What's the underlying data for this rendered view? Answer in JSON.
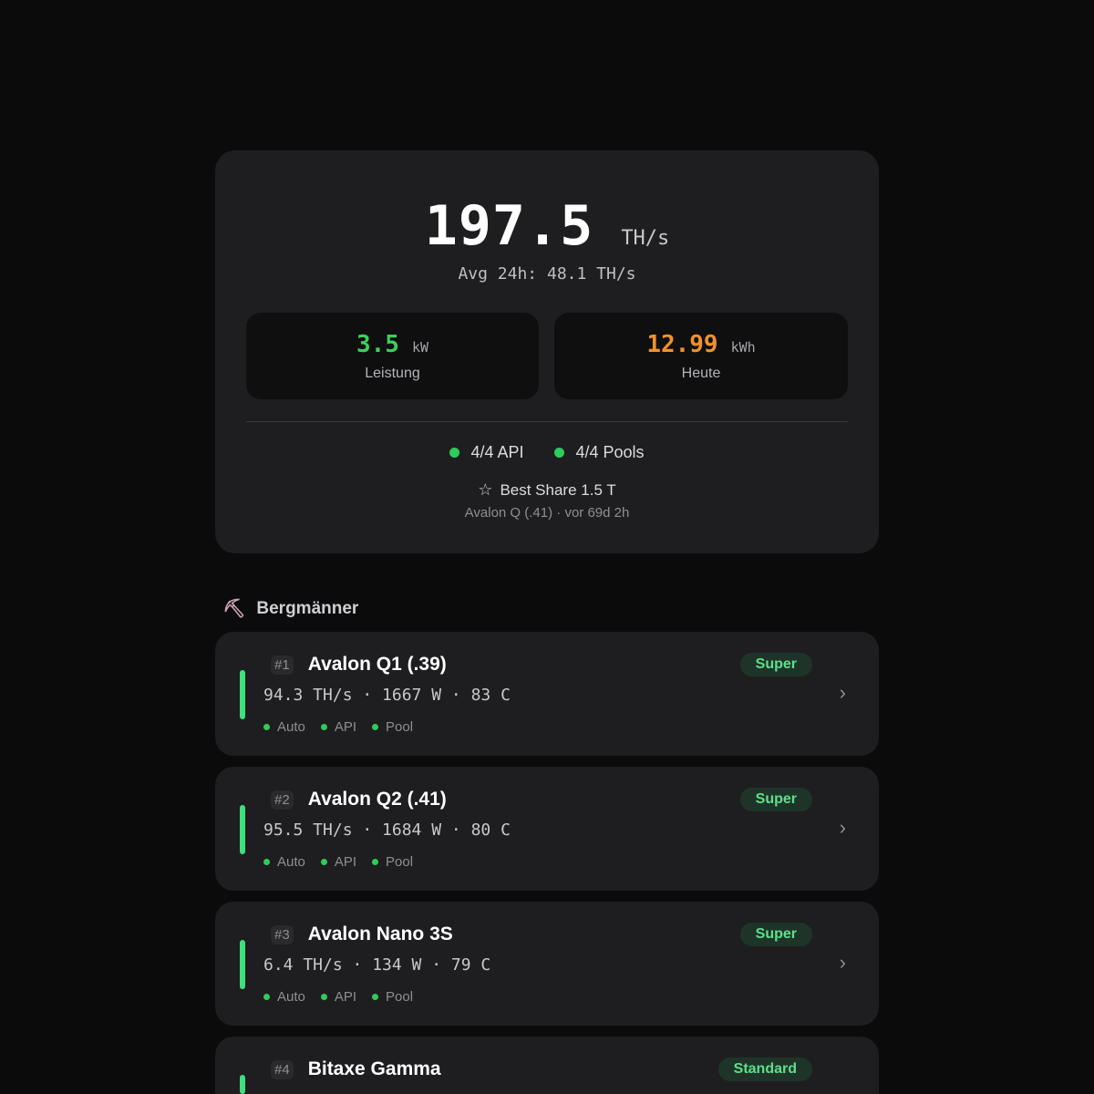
{
  "summary": {
    "hashrate_value": "197.5",
    "hashrate_unit": "TH/s",
    "avg_line": "Avg 24h: 48.1 TH/s",
    "power": {
      "value": "3.5",
      "unit": "kW",
      "label": "Leistung",
      "color": "#3ecf5d"
    },
    "energy": {
      "value": "12.99",
      "unit": "kWh",
      "label": "Heute",
      "color": "#f0922b"
    },
    "api_status": "4/4 API",
    "pool_status": "4/4 Pools",
    "best_share": "Best Share 1.5 T",
    "best_share_sub": "Avalon Q (.41) · vor 69d 2h"
  },
  "section": {
    "title": "Bergmänner",
    "icon": "pickaxe-icon"
  },
  "miners": [
    {
      "rank": "#1",
      "name": "Avalon Q1 (.39)",
      "metrics": "94.3 TH/s · 1667 W · 83 C",
      "badge": "Super",
      "flags": [
        "Auto",
        "API",
        "Pool"
      ]
    },
    {
      "rank": "#2",
      "name": "Avalon Q2 (.41)",
      "metrics": "95.5 TH/s · 1684 W · 80 C",
      "badge": "Super",
      "flags": [
        "Auto",
        "API",
        "Pool"
      ]
    },
    {
      "rank": "#3",
      "name": "Avalon Nano 3S",
      "metrics": "6.4 TH/s · 134 W · 79 C",
      "badge": "Super",
      "flags": [
        "Auto",
        "API",
        "Pool"
      ]
    },
    {
      "rank": "#4",
      "name": "Bitaxe Gamma",
      "metrics": "",
      "badge": "Standard",
      "flags": []
    }
  ],
  "colors": {
    "accent_green": "#3ee07a",
    "badge_bg": "#1f3429"
  }
}
